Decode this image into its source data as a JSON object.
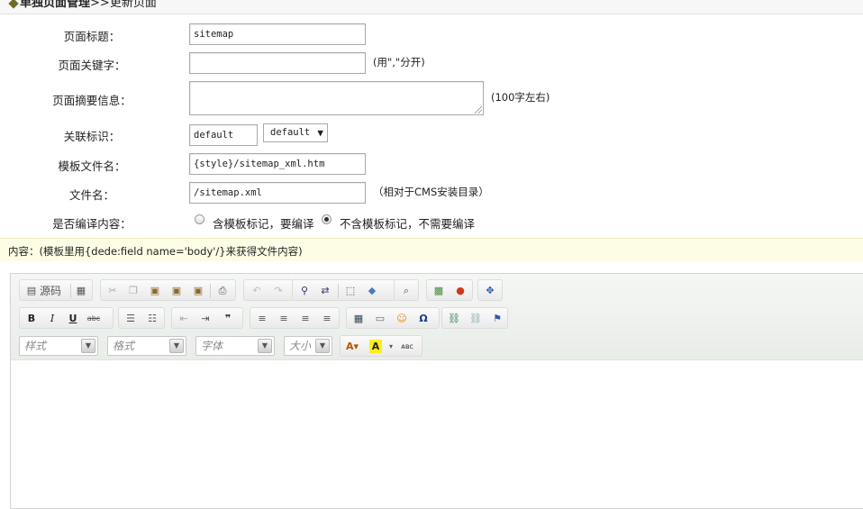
{
  "header": {
    "section": "单独页面管理",
    "separator": ">>",
    "page": "更新页面"
  },
  "form": {
    "title_label": "页面标题：",
    "title_value": "sitemap",
    "keywords_label": "页面关键字：",
    "keywords_value": "",
    "keywords_hint": "(用\",\"分开)",
    "summary_label": "页面摘要信息：",
    "summary_value": "",
    "summary_hint": "(100字左右)",
    "tag_label": "关联标识：",
    "tag_value": "default",
    "tag_select": "default",
    "template_label": "模板文件名：",
    "template_value": "{style}/sitemap_xml.htm",
    "filename_label": "文件名：",
    "filename_value": "/sitemap.xml",
    "filename_hint": "（相对于CMS安装目录）",
    "compile_label": "是否编译内容：",
    "compile_options": [
      {
        "label": "含模板标记，要编译",
        "checked": false
      },
      {
        "label": "不含模板标记，不需要编译",
        "checked": true
      }
    ]
  },
  "content": {
    "label": "内容：(模板里用{dede:field name='body'/}来获得文件内容)"
  },
  "editor": {
    "source_label": "源码",
    "style_combo": "样式",
    "format_combo": "格式",
    "font_combo": "字体",
    "size_combo": "大小",
    "icons": {
      "source": "source-icon",
      "template": "templates-icon",
      "cut": "cut-icon",
      "copy": "copy-icon",
      "paste": "paste-icon",
      "paste_text": "paste-text-icon",
      "paste_word": "paste-word-icon",
      "print": "print-icon",
      "undo": "undo-icon",
      "redo": "redo-icon",
      "find": "find-icon",
      "replace": "replace-icon",
      "select_all": "select-all-icon",
      "remove_format": "eraser-icon",
      "preview": "preview-icon",
      "image": "image-icon",
      "flash": "flash-icon",
      "maximize": "maximize-icon",
      "bold": "B",
      "italic": "I",
      "underline": "U",
      "strike": "abc"
    }
  }
}
